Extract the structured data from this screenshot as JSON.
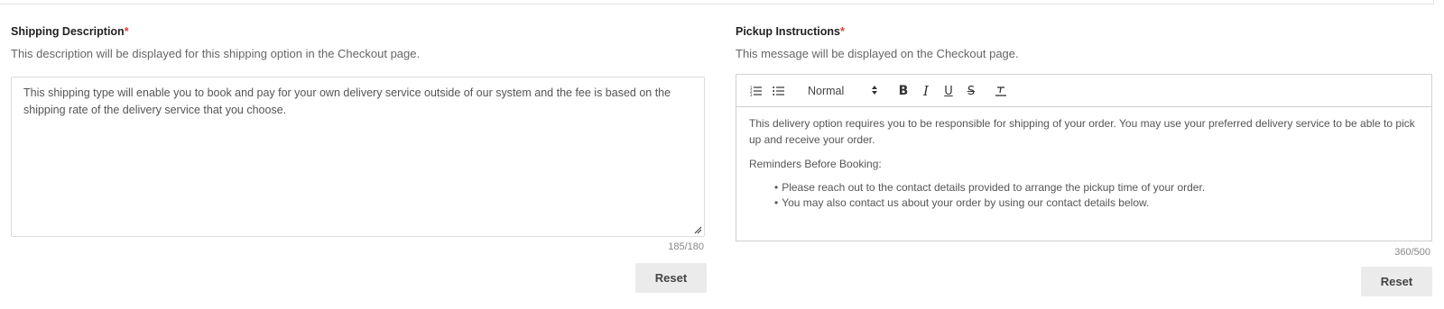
{
  "left": {
    "label": "Shipping Description",
    "required_mark": "*",
    "help": "This description will be displayed for this shipping option in the Checkout page.",
    "value": "This shipping type will enable you to book and pay for your own delivery service outside of our system and the fee is based on the shipping rate of the delivery service that you choose.",
    "counter": "185/180",
    "reset_label": "Reset"
  },
  "right": {
    "label": "Pickup Instructions",
    "required_mark": "*",
    "help": "This message will be displayed on the Checkout page.",
    "toolbar": {
      "format_value": "Normal",
      "bold": "B",
      "italic": "I",
      "underline": "U",
      "strike": "S"
    },
    "content": {
      "paragraph1": "This delivery option requires you to be responsible for shipping of your order. You may use your preferred delivery service to be able to pick up and receive your order.",
      "paragraph2": "Reminders Before Booking:",
      "bullets": [
        "Please reach out to the contact details provided to arrange the pickup time of your order.",
        "You may also contact us about your order by using our contact details below."
      ]
    },
    "counter": "360/500",
    "reset_label": "Reset"
  },
  "icons": {
    "ordered_list": "ordered-list-icon",
    "bullet_list": "bullet-list-icon",
    "select_arrows": "updown-arrows-icon",
    "clean": "clear-format-icon",
    "resize": "resize-handle-icon"
  }
}
